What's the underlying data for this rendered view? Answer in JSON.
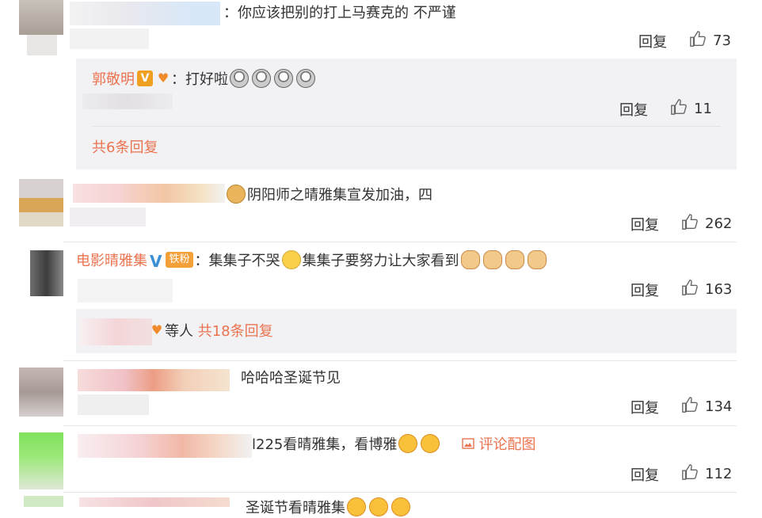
{
  "comments": [
    {
      "text": "：你应该把别的打上马赛克的 不严谨",
      "reply_label": "回复",
      "likes": "73"
    },
    {
      "text": "阴阳师之晴雅集宣发加油，四",
      "reply_label": "回复",
      "likes": "262"
    },
    {
      "user": "电影晴雅集",
      "fan_badge": "铁粉",
      "text_a": "：集集子不哭",
      "text_b": "集集子要努力让大家看到",
      "reply_label": "回复",
      "likes": "163"
    },
    {
      "text": "哈哈哈圣诞节见",
      "reply_label": "回复",
      "likes": "134"
    },
    {
      "text": "l225看晴雅集，看博雅",
      "image_link": "评论配图",
      "reply_label": "回复",
      "likes": "112"
    },
    {
      "text": "圣诞节看晴雅集"
    }
  ],
  "nested_reply": {
    "user": "郭敬明",
    "text": "：打好啦",
    "reply_label": "回复",
    "likes": "11",
    "more": "共6条回复"
  },
  "collapsed_replies": {
    "suffix": "等人",
    "more": "共18条回复"
  },
  "colors": {
    "accent": "#eb7350",
    "reply_bg": "#f2f2f5",
    "verified_blue": "#3b8fd6"
  }
}
